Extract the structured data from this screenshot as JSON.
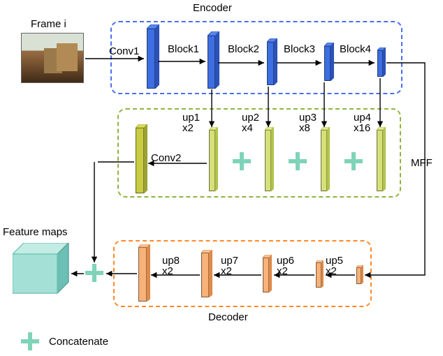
{
  "title": {
    "encoder": "Encoder",
    "decoder": "Decoder"
  },
  "input_label": "Frame i",
  "output_label": "Feature maps",
  "encoder": {
    "conv": "Conv1",
    "blocks": [
      "Block1",
      "Block2",
      "Block3",
      "Block4"
    ]
  },
  "mff": {
    "label": "MFF",
    "conv": "Conv2",
    "ups": [
      {
        "name": "up1",
        "scale": "x2"
      },
      {
        "name": "up2",
        "scale": "x4"
      },
      {
        "name": "up3",
        "scale": "x8"
      },
      {
        "name": "up4",
        "scale": "x16"
      }
    ]
  },
  "decoder": {
    "ups": [
      {
        "name": "up5",
        "scale": "x2"
      },
      {
        "name": "up6",
        "scale": "x2"
      },
      {
        "name": "up7",
        "scale": "x2"
      },
      {
        "name": "up8",
        "scale": "x2"
      }
    ]
  },
  "legend": {
    "concatenate": "Concatenate"
  },
  "colors": {
    "encoder_box": "#4b6ef2",
    "mff_box": "#8fb441",
    "decoder_box": "#ff8a27",
    "encoder_fill": "#3e6fe1",
    "encoder_fill_dark": "#2c52b8",
    "mff_fill": "#d6e079",
    "mff_fill_dark": "#b3c44e",
    "conv2_fill": "#c7cc42",
    "conv2_fill_dark": "#9ca232",
    "decoder_fill": "#f7b27a",
    "decoder_fill_dark": "#dd8b4a",
    "output_fill": "#a5e0d6",
    "output_fill_dark": "#6cc0b3",
    "plus": "#7fd3b8"
  }
}
